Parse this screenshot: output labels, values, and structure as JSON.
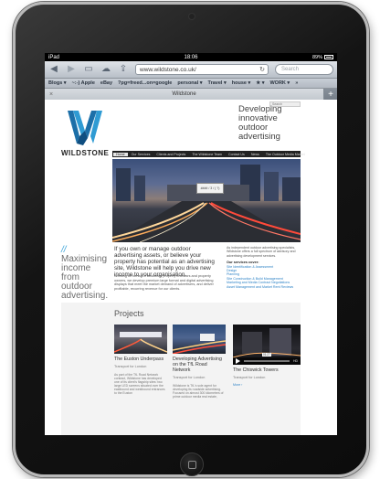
{
  "status": {
    "carrier": "iPad",
    "time": "18:06",
    "battery": "89%"
  },
  "browser": {
    "url": "www.wildstone.co.uk/",
    "search_placeholder": "Search",
    "bookmarks": [
      "Blogs ▾",
      "~:-) Apple",
      "eBay",
      "?pg=freed...on=google",
      "personal ▾",
      "Travel ▾",
      "house ▾",
      "★ ▾",
      "WORK ▾",
      "»"
    ],
    "tab_title": "Wildstone"
  },
  "site": {
    "search_placeholder": "Search",
    "brand": "WILDSTONE",
    "tagline": "Developing innovative outdoor advertising",
    "nav": [
      "Home",
      "Our Services",
      "Clients and Projects",
      "The Wildstone Team",
      "Contact Us",
      "News",
      "The Outdoor Media Market"
    ],
    "billboard_text": "#### / 3 / ( ?)",
    "maximising": "Maximising income from outdoor advertising.",
    "intro": "If you own or manage outdoor advertising assets, or believe your property has potential as an advertising site, Wildstone will help you drive new income to your organisation.",
    "intro_small": "Working on behalf of landlords, property investors and property owners, we develop premium large format and digital advertising displays that meet the market demand of advertisers, and deliver profitable, recurring revenue for our clients.",
    "services_intro": "As independent outdoor advertising specialists, Wildstone offers a full spectrum of advisory and advertising development services.",
    "services_heading": "Our services cover:",
    "services": [
      "Site Identification & Assessment",
      "Design",
      "Planning",
      "Site Construction & Build Management",
      "Marketing and Media Contract Negotiations",
      "Asset Management and Market Rent Reviews"
    ],
    "projects_title": "Projects",
    "projects": [
      {
        "title": "The Euston Underpass",
        "client": "Transport for London",
        "desc": "As part of the TfL Road Network contract, Wildstone has developed one of its client's flagship sites: two large LED screens situated over the eastbound and westbound entrances to the Euston",
        "more": ""
      },
      {
        "title": "Developing Advertising on the TfL Road Network",
        "client": "Transport for London",
        "desc": "Wildstone is TfL's sole agent for developing its roadside advertising. Focused on almost 300 kilometres of prime outdoor media real estate,",
        "more": ""
      },
      {
        "title": "The Chiswick Towers",
        "client": "Transport for London",
        "desc": "",
        "more": "More ›",
        "video_time": "01:27",
        "hd": "HD"
      }
    ]
  }
}
